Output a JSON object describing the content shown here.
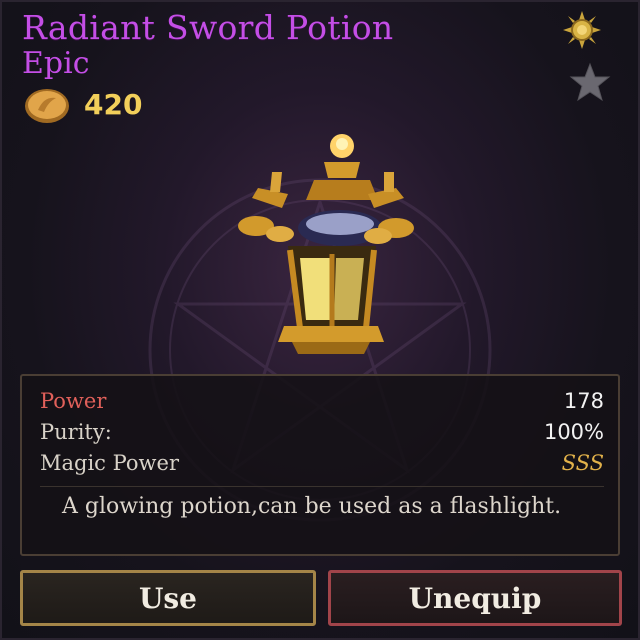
{
  "item": {
    "name": "Radiant Sword Potion",
    "rarity": "Epic",
    "price": "420"
  },
  "icons": {
    "coin": "gold-coin-icon",
    "favorite": "star-icon",
    "settings": "sun-gear-icon"
  },
  "stats": [
    {
      "label": "Power",
      "value": "178"
    },
    {
      "label": "Purity:",
      "value": "100%"
    },
    {
      "label": "Magic Power",
      "value": "SSS"
    }
  ],
  "description": "A glowing potion,can be used as a flashlight.",
  "buttons": {
    "use": "Use",
    "unequip": "Unequip"
  },
  "colors": {
    "rarity_epic": "#c44ee6",
    "price": "#f2cf5a",
    "power_label": "#e0605a",
    "grade": "#e2b24a",
    "use_border": "#a48548",
    "unequip_border": "#a1444a"
  }
}
